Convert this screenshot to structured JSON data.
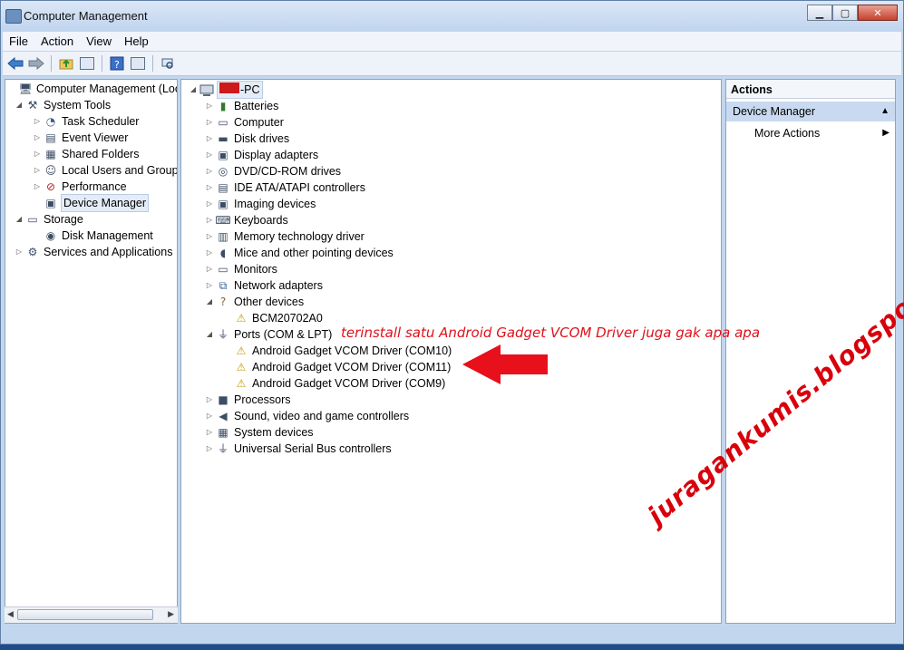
{
  "window": {
    "title": "Computer Management"
  },
  "menu": [
    "File",
    "Action",
    "View",
    "Help"
  ],
  "left_tree": [
    {
      "label": "Computer Management (Local",
      "icon": "computer-management-icon",
      "indent": 0,
      "exp": ""
    },
    {
      "label": "System Tools",
      "icon": "tools-icon",
      "indent": 1,
      "exp": "◢"
    },
    {
      "label": "Task Scheduler",
      "icon": "clock-icon",
      "indent": 2,
      "exp": "▷"
    },
    {
      "label": "Event Viewer",
      "icon": "event-viewer-icon",
      "indent": 2,
      "exp": "▷"
    },
    {
      "label": "Shared Folders",
      "icon": "shared-folder-icon",
      "indent": 2,
      "exp": "▷"
    },
    {
      "label": "Local Users and Groups",
      "icon": "users-icon",
      "indent": 2,
      "exp": "▷"
    },
    {
      "label": "Performance",
      "icon": "performance-icon",
      "indent": 2,
      "exp": "▷"
    },
    {
      "label": "Device Manager",
      "icon": "device-manager-icon",
      "indent": 2,
      "exp": "",
      "selected": true
    },
    {
      "label": "Storage",
      "icon": "storage-icon",
      "indent": 1,
      "exp": "◢"
    },
    {
      "label": "Disk Management",
      "icon": "disk-icon",
      "indent": 2,
      "exp": ""
    },
    {
      "label": "Services and Applications",
      "icon": "services-icon",
      "indent": 1,
      "exp": "▷"
    }
  ],
  "device_tree": {
    "root_suffix": "-PC",
    "items": [
      {
        "label": "Batteries",
        "icon": "battery-icon",
        "level": 1,
        "exp": "▷"
      },
      {
        "label": "Computer",
        "icon": "monitor-icon",
        "level": 1,
        "exp": "▷"
      },
      {
        "label": "Disk drives",
        "icon": "disk-drive-icon",
        "level": 1,
        "exp": "▷"
      },
      {
        "label": "Display adapters",
        "icon": "display-adapter-icon",
        "level": 1,
        "exp": "▷"
      },
      {
        "label": "DVD/CD-ROM drives",
        "icon": "dvd-icon",
        "level": 1,
        "exp": "▷"
      },
      {
        "label": "IDE ATA/ATAPI controllers",
        "icon": "ide-icon",
        "level": 1,
        "exp": "▷"
      },
      {
        "label": "Imaging devices",
        "icon": "camera-icon",
        "level": 1,
        "exp": "▷"
      },
      {
        "label": "Keyboards",
        "icon": "keyboard-icon",
        "level": 1,
        "exp": "▷"
      },
      {
        "label": "Memory technology driver",
        "icon": "memory-icon",
        "level": 1,
        "exp": "▷"
      },
      {
        "label": "Mice and other pointing devices",
        "icon": "mouse-icon",
        "level": 1,
        "exp": "▷"
      },
      {
        "label": "Monitors",
        "icon": "monitor-icon",
        "level": 1,
        "exp": "▷"
      },
      {
        "label": "Network adapters",
        "icon": "network-icon",
        "level": 1,
        "exp": "▷"
      },
      {
        "label": "Other devices",
        "icon": "unknown-device-icon",
        "level": 1,
        "exp": "◢"
      },
      {
        "label": "BCM20702A0",
        "icon": "warning-device-icon",
        "level": 2,
        "exp": ""
      },
      {
        "label": "Ports (COM & LPT)",
        "icon": "port-icon",
        "level": 1,
        "exp": "◢"
      },
      {
        "label": "Android Gadget VCOM Driver (COM10)",
        "icon": "warning-device-icon",
        "level": 2,
        "exp": ""
      },
      {
        "label": "Android Gadget VCOM Driver (COM11)",
        "icon": "warning-device-icon",
        "level": 2,
        "exp": ""
      },
      {
        "label": "Android Gadget VCOM Driver (COM9)",
        "icon": "warning-device-icon",
        "level": 2,
        "exp": ""
      },
      {
        "label": "Processors",
        "icon": "processor-icon",
        "level": 1,
        "exp": "▷"
      },
      {
        "label": "Sound, video and game controllers",
        "icon": "speaker-icon",
        "level": 1,
        "exp": "▷"
      },
      {
        "label": "System devices",
        "icon": "system-device-icon",
        "level": 1,
        "exp": "▷"
      },
      {
        "label": "Universal Serial Bus controllers",
        "icon": "usb-icon",
        "level": 1,
        "exp": "▷"
      }
    ]
  },
  "actions": {
    "header": "Actions",
    "section": "Device Manager",
    "more": "More Actions"
  },
  "annotation": "terinstall satu Android Gadget VCOM Driver juga gak apa apa",
  "watermark": "juragankumis.blogspot.com",
  "colors": {
    "annotation_red": "#e0101a",
    "selection": "#e3ecf7",
    "actions_highlight": "#c9daf0"
  }
}
